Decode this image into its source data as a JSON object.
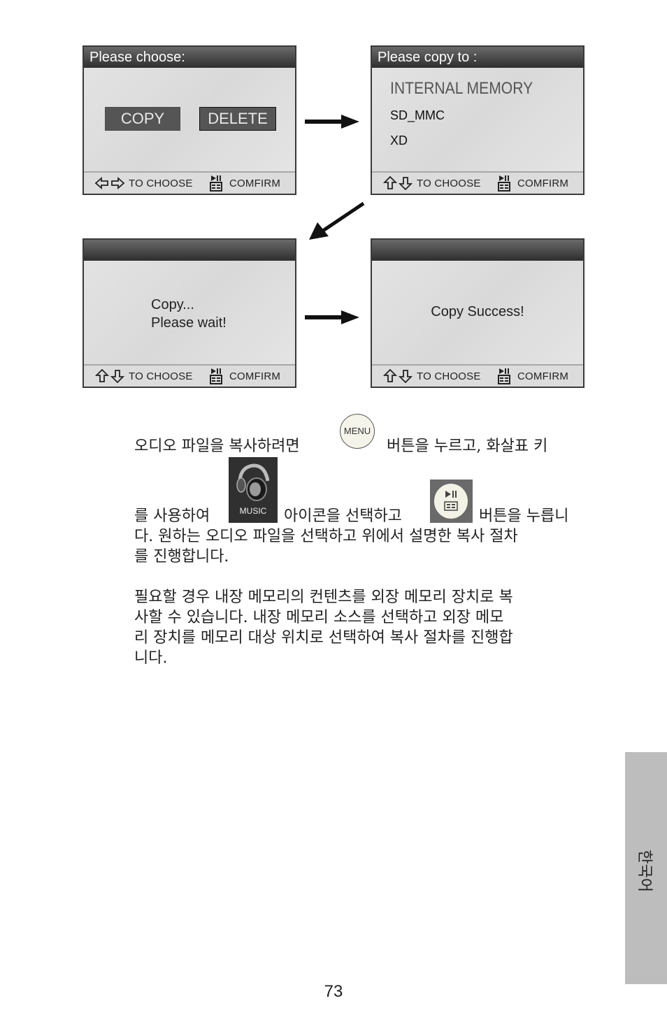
{
  "screens": {
    "choose": {
      "title": "Please choose:",
      "buttons": [
        "COPY",
        "DELETE"
      ],
      "footer": {
        "nav_label": "TO CHOOSE",
        "confirm_label": "COMFIRM",
        "nav_icon": "left-right-arrows"
      }
    },
    "copy_to": {
      "title": "Please copy to :",
      "options": [
        "INTERNAL MEMORY",
        "SD_MMC",
        "XD"
      ],
      "selected_index": 0,
      "footer": {
        "nav_label": "TO CHOOSE",
        "confirm_label": "COMFIRM",
        "nav_icon": "up-down-arrows"
      }
    },
    "copying": {
      "title": "",
      "message_line1": "Copy...",
      "message_line2": "Please wait!",
      "footer": {
        "nav_label": "TO CHOOSE",
        "confirm_label": "COMFIRM",
        "nav_icon": "up-down-arrows"
      }
    },
    "success": {
      "title": "",
      "message": "Copy Success!",
      "footer": {
        "nav_label": "TO CHOOSE",
        "confirm_label": "COMFIRM",
        "nav_icon": "up-down-arrows"
      }
    }
  },
  "icons": {
    "menu_label": "MENU",
    "music_label": "MUSIC"
  },
  "paragraph1": {
    "line1_a": "오디오 파일을 복사하려면",
    "line1_b": "버튼을 누르고, 화살표 키",
    "line2_a": "를 사용하여",
    "line2_b": "아이콘을 선택하고",
    "line2_c": "버튼을 누릅니",
    "line3": "다.  원하는 오디오 파일을 선택하고 위에서 설명한 복사 절차",
    "line4": "를 진행합니다."
  },
  "paragraph2": {
    "line1": "필요할 경우 내장 메모리의 컨텐츠를 외장 메모리 장치로 복",
    "line2": "사할 수 있습니다.  내장 메모리 소스를 선택하고 외장 메모",
    "line3": "리 장치를 메모리 대상 위치로 선택하여 복사 절차를 진행합",
    "line4": "니다."
  },
  "side_tab": {
    "label": "한국어"
  },
  "page_number": "73",
  "colors": {
    "titlebar": "#2e2e2e",
    "screen_bg": "#e0e0e0",
    "button": "#555555",
    "side_tab": "#bdbdbd"
  }
}
